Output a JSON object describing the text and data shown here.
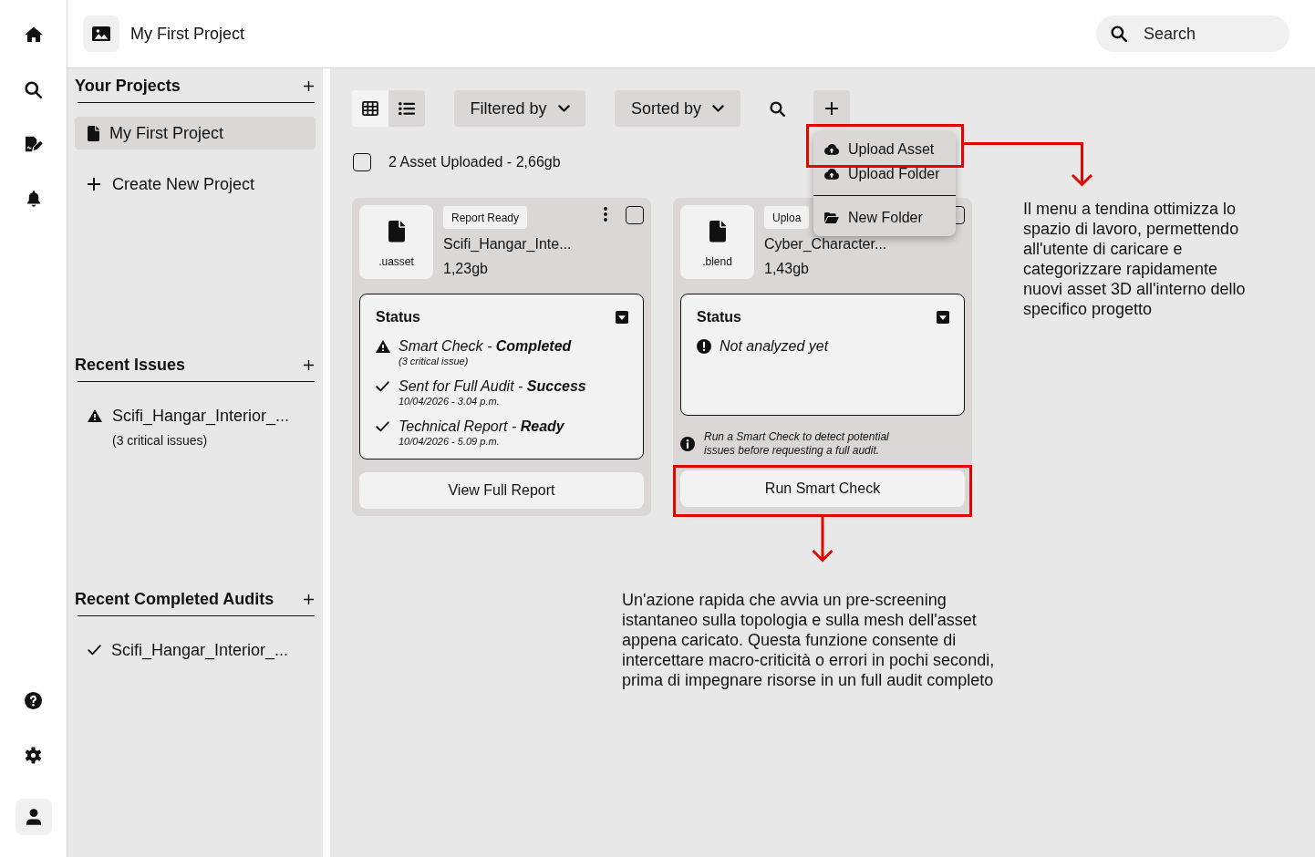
{
  "header": {
    "title": "My First Project",
    "search": {
      "placeholder": "Search"
    }
  },
  "sidebar": {
    "sections": [
      {
        "title": "Your Projects",
        "items": [
          {
            "kind": "project",
            "label": "My First Project",
            "selected": true
          },
          {
            "kind": "create",
            "label": "Create New Project"
          }
        ]
      },
      {
        "title": "Recent Issues",
        "items": [
          {
            "kind": "issue",
            "label": "Scifi_Hangar_Interior_...",
            "detail": "(3 critical issues)"
          }
        ]
      },
      {
        "title": "Recent Completed Audits",
        "items": [
          {
            "kind": "audit",
            "label": "Scifi_Hangar_Interior_..."
          }
        ]
      }
    ]
  },
  "toolbar": {
    "view_modes": [
      {
        "kind": "grid",
        "selected": true
      },
      {
        "kind": "list",
        "selected": false
      }
    ],
    "filter_label": "Filtered by",
    "sort_label": "Sorted by"
  },
  "add_menu": {
    "groups": [
      {
        "items": [
          {
            "kind": "upload",
            "label": "Upload Asset"
          },
          {
            "kind": "upload",
            "label": "Upload Folder"
          }
        ]
      },
      {
        "items": [
          {
            "kind": "folder",
            "label": "New Folder"
          }
        ]
      }
    ]
  },
  "selection": {
    "checked": false,
    "summary": "2 Asset Uploaded - 2,66gb"
  },
  "assets": [
    {
      "extension": ".uasset",
      "badge": "Report Ready",
      "name": "Scifi_Hangar_Inte...",
      "size": "1,23gb",
      "more_button": true,
      "checked": false,
      "status": {
        "title": "Status",
        "entries": [
          {
            "kind": "warning",
            "text": "Smart Check - **Completed**",
            "detail": "(3 critical issue)"
          },
          {
            "kind": "done",
            "text": "Sent for Full Audit - **Success**",
            "detail": "10/04/2026 - 3.04 p.m."
          },
          {
            "kind": "done",
            "text": "Technical Report - **Ready**",
            "detail": "10/04/2026 - 5.09 p.m."
          }
        ]
      },
      "action": "View Full Report"
    },
    {
      "extension": ".blend",
      "badge": "Uploa",
      "name": "Cyber_Character...",
      "size": "1,43gb",
      "more_button": false,
      "checked": false,
      "status": {
        "title": "Status",
        "entries": [
          {
            "kind": "pending",
            "text": "Not analyzed yet"
          }
        ]
      },
      "note": "Run a Smart Check to detect potential issues before requesting a full audit.",
      "action": "Run Smart Check"
    }
  ],
  "annotations": [
    {
      "kind": "menu",
      "text": "Il menu a tendina ottimizza lo spazio di lavoro, permettendo all'utente di caricare e categorizzare rapidamente nuovi asset 3D all'interno dello specifico progetto"
    },
    {
      "kind": "action",
      "text": "Un'azione rapida che avvia un pre-screening istantaneo sulla topologia e sulla mesh dell'asset appena caricato. Questa funzione consente di intercettare macro-criticità o errori in pochi secondi, prima di impegnare risorse in un full audit completo"
    }
  ]
}
